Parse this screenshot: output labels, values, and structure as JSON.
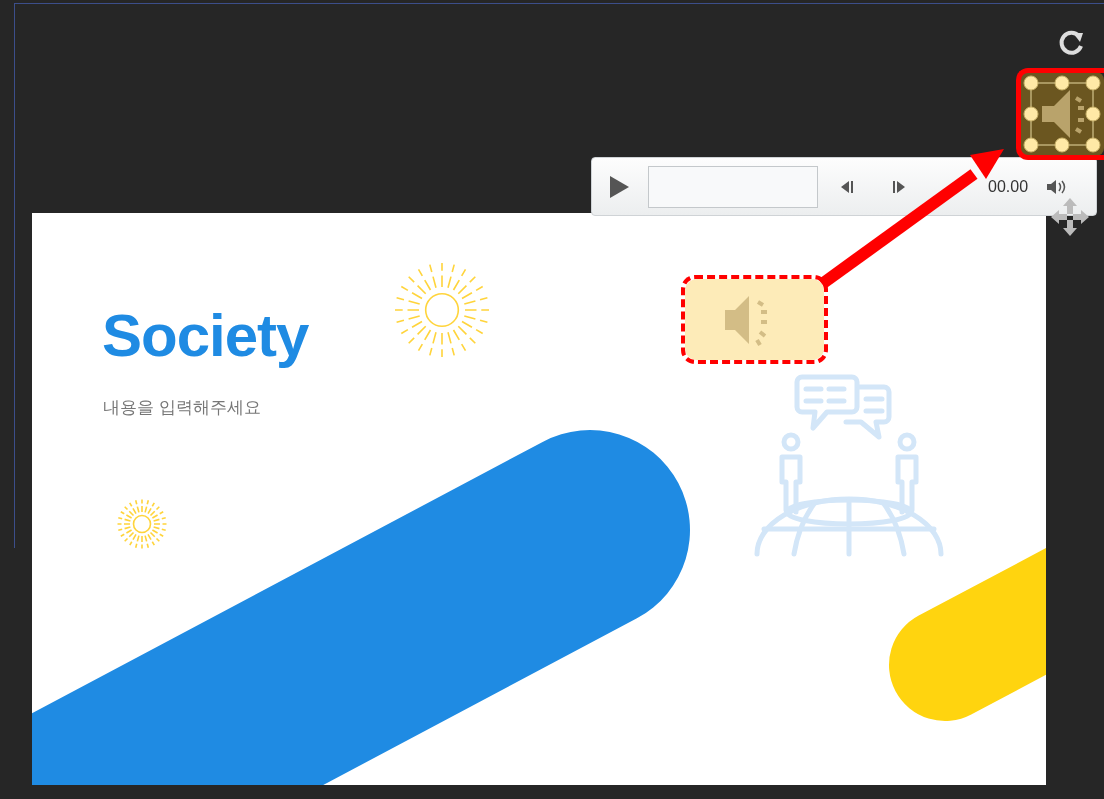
{
  "slide": {
    "title": "Society",
    "subtitle": "내용을 입력해주세요"
  },
  "audio_player": {
    "time": "00.00"
  },
  "audio_icon": {
    "selected": true
  },
  "annotations": [
    {
      "kind": "solid-box"
    },
    {
      "kind": "dashed-box"
    },
    {
      "kind": "arrow"
    }
  ]
}
